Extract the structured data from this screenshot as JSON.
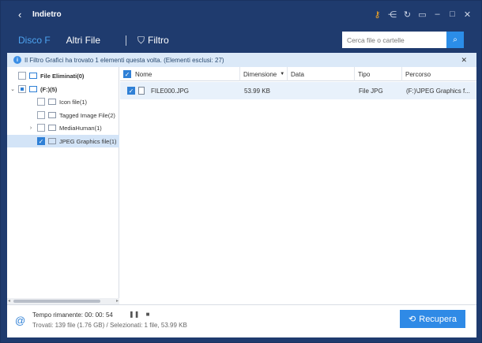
{
  "window": {
    "title": "Indietro"
  },
  "nav": {
    "tab_disk": "Disco F",
    "tab_all": "Altri File",
    "filter": "Filtro",
    "search_placeholder": "Cerca file o cartelle"
  },
  "info": {
    "text": "Il Filtro Grafici ha trovato 1 elementi questa volta. (Elementi esclusi: 27)"
  },
  "tree": {
    "items": [
      {
        "label": "File Eliminati(0)"
      },
      {
        "label": "(F:)(5)"
      },
      {
        "label": "Icon file(1)"
      },
      {
        "label": "Tagged Image File(2)"
      },
      {
        "label": "MediaHuman(1)"
      },
      {
        "label": "JPEG Graphics file(1)"
      }
    ]
  },
  "table": {
    "headers": [
      "Nome",
      "Dimensione",
      "Data",
      "Tipo",
      "Percorso"
    ],
    "rows": [
      {
        "name": "FILE000.JPG",
        "size": "53.99 KB",
        "date": "",
        "type": "File JPG",
        "path": "(F:)\\JPEG Graphics f..."
      }
    ]
  },
  "footer": {
    "time": "Tempo rimanente: 00: 00: 54",
    "found": "Trovati: 139 file (1.76 GB) / Selezionati: 1 file, 53.99 KB",
    "recover_label": "Recupera"
  },
  "colors": {
    "titlebar": "#1f3b6e",
    "accent": "#2f8ae6",
    "active_tab": "#4da3f0",
    "selected_row": "#e8f1fb"
  }
}
